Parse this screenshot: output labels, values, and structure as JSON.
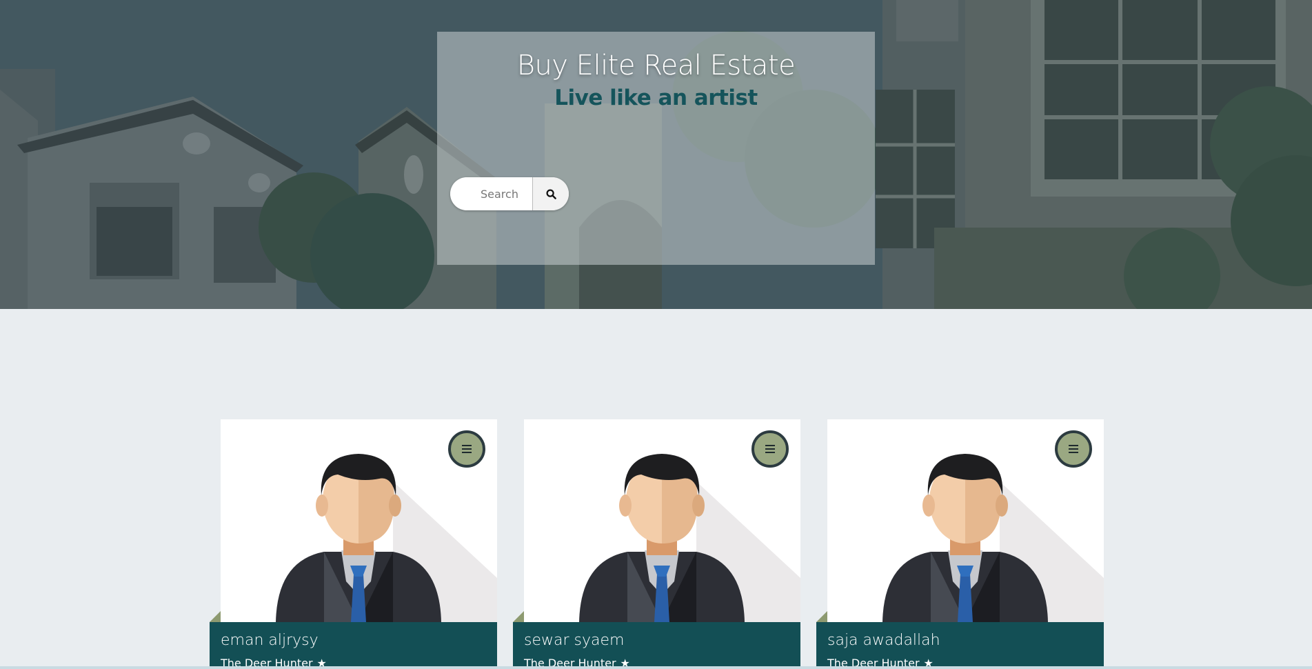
{
  "hero": {
    "title": "Buy Elite Real Estate",
    "subtitle": "Live like an artist",
    "search": {
      "placeholder": "Search",
      "icon": "search-icon"
    }
  },
  "agents": [
    {
      "name": "eman aljrysy",
      "movie": "The Deer Hunter",
      "menu_icon": "hamburger-icon",
      "star_icon": "star-icon"
    },
    {
      "name": "sewar syaem",
      "movie": "The Deer Hunter",
      "menu_icon": "hamburger-icon",
      "star_icon": "star-icon"
    },
    {
      "name": "saja awadallah",
      "movie": "The Deer Hunter",
      "menu_icon": "hamburger-icon",
      "star_icon": "star-icon"
    }
  ],
  "colors": {
    "accent_teal": "#134f55",
    "menu_olive": "#9aa882",
    "page_bg": "#e9edf0"
  }
}
